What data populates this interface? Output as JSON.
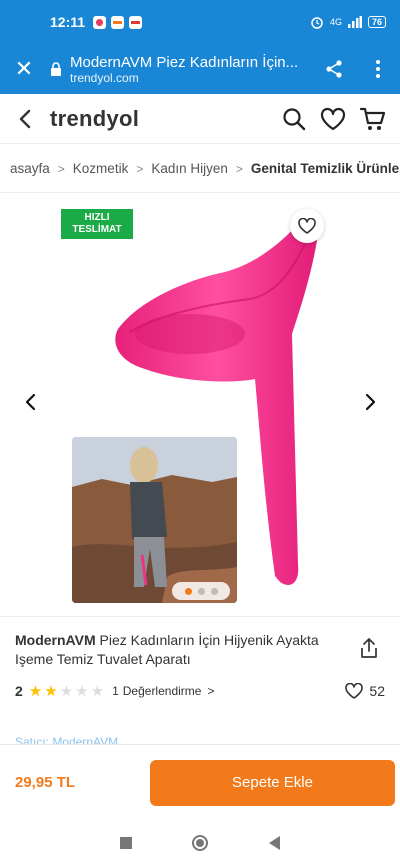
{
  "status_bar": {
    "time": "12:11",
    "network": "4G",
    "battery": "76"
  },
  "browser": {
    "title": "ModernAVM Piez Kadınların İçin...",
    "url": "trendyol.com"
  },
  "header": {
    "logo": "trendyol"
  },
  "breadcrumb": [
    "asayfa",
    "Kozmetik",
    "Kadın Hijyen",
    "Genital Temizlik Ürünleri"
  ],
  "gallery": {
    "badge_line1": "HIZLI",
    "badge_line2": "TESLİMAT",
    "image_count": 3,
    "active_index": 0
  },
  "product": {
    "brand": "ModernAVM",
    "name": " Piez Kadınların İçin Hijyenik Ayakta Işeme Temiz Tuvalet Aparatı",
    "rating": "2",
    "stars_filled": 2,
    "stars_total": 5,
    "rating_count": "1",
    "rating_label": "Değerlendirme",
    "likes": "52",
    "seller_peek": "Satıcı: ModernAVM"
  },
  "action": {
    "price": "29,95 TL",
    "add_to_cart": "Sepete Ekle"
  },
  "colors": {
    "browser_blue": "#1a87d6",
    "brand_orange": "#f27a1a",
    "badge_green": "#1aaa46",
    "product_pink": "#f2338a"
  }
}
